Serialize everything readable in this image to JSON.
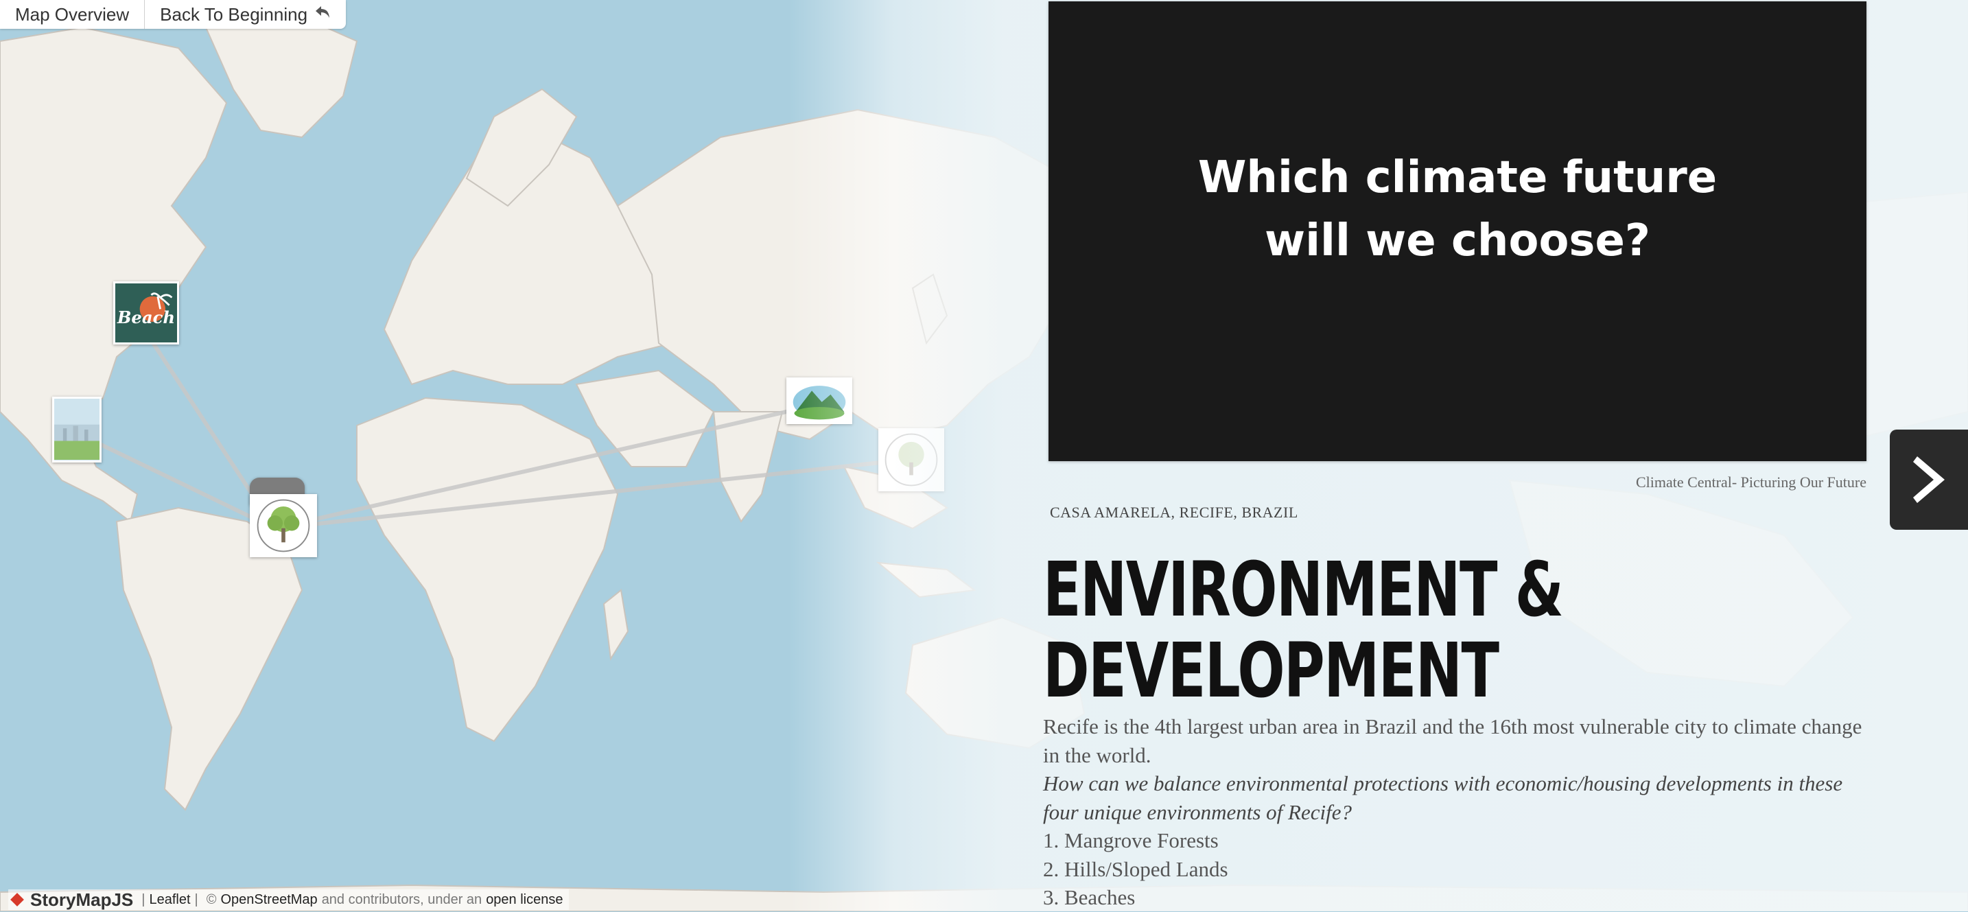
{
  "nav": {
    "map_overview": "Map Overview",
    "back_to_beginning": "Back To Beginning",
    "back_icon": "return-arrow-icon"
  },
  "media": {
    "slide_text_line1": "Which climate future",
    "slide_text_line2": "will we choose?",
    "caption": "Climate Central- Picturing Our Future"
  },
  "story": {
    "location": "CASA AMARELA, RECIFE, BRAZIL",
    "headline_line1": "ENVIRONMENT &",
    "headline_line2": "DEVELOPMENT",
    "paragraph": "Recife is the 4th largest urban area in Brazil and the 16th most vulnerable city to climate change in the world.",
    "question": "How can we balance environmental protections with economic/housing developments in these four unique environments of Recife?",
    "list": [
      "1. Mangrove Forests",
      "2. Hills/Sloped Lands",
      "3. Beaches"
    ]
  },
  "markers": {
    "beach_label": "Beach"
  },
  "attribution": {
    "brand": "StoryMapJS",
    "leaflet": "Leaflet",
    "sep": "|",
    "copyright": "©",
    "osm": "OpenStreetMap",
    "contributors": "and contributors, under an",
    "license": "open license"
  },
  "colors": {
    "water": "#aacfdf",
    "land": "#f2efe9",
    "panel_dark": "#1a1a1a",
    "beach_tile": "#2f5f56",
    "brand_red": "#d73a2a"
  },
  "icons": {
    "next": "chevron-right-icon"
  }
}
